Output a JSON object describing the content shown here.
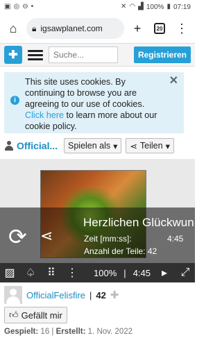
{
  "statusbar": {
    "battery": "100%",
    "time": "07:19"
  },
  "browser": {
    "url": "igsawplanet.com",
    "tab_count": "20"
  },
  "header": {
    "search_placeholder": "Suche...",
    "register_label": "Registrieren"
  },
  "cookie": {
    "text_before": "This site uses cookies. By continuing to browse you are agreeing to our use of cookies. ",
    "link_text": "Click here",
    "text_after": " to learn more about our cookie policy."
  },
  "puzzle_header": {
    "title": "Official...",
    "play_as_label": "Spielen als",
    "share_label": "Teilen"
  },
  "puzzle": {
    "congrats": "Herzlichen Glückwun",
    "time_label": "Zeit [mm:ss]:",
    "time_value": "4:45",
    "pieces_label": "Anzahl der Teile:",
    "pieces_value": "42",
    "zoom": "100%",
    "timer": "4:45"
  },
  "author": {
    "name": "OfficialFelisfire",
    "separator": "|",
    "pieces": "42"
  },
  "like_label": "Gefällt mir",
  "meta": {
    "played_label": "Gespielt:",
    "played_value": "16",
    "separator": "|",
    "created_label": "Erstellt:",
    "created_value": "1. Nov. 2022"
  },
  "colors": {
    "brand": "#27a0d8",
    "cookie_bg": "#dff0f8"
  }
}
